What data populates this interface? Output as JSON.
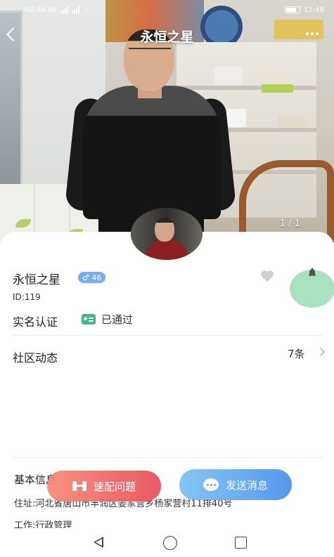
{
  "status_bar": {
    "left": "HD 46 46",
    "time": "12:48"
  },
  "header": {
    "title": "永恒之星",
    "photo_counter": "1 / 1"
  },
  "profile": {
    "name": "永恒之星",
    "gender_age": "♂ 46",
    "id": "ID:119",
    "verification": {
      "label": "实名认证",
      "status": "已通过"
    },
    "community": {
      "label": "社区动态",
      "count": "7条"
    },
    "basic_info": {
      "label": "基本信息",
      "address": "住址:河北省唐山市丰润区姜家营乡杨家营村11排40号",
      "work": "工作:行政管理"
    }
  },
  "actions": {
    "match_label": "速配问题",
    "send_label": "发送消息"
  },
  "colors": {
    "badge_blue": "#77aef0",
    "verify_green": "#39b88a",
    "match_button": "#e9525c",
    "send_button": "#4e94e9",
    "bell_bubble": "#a8e2c2"
  },
  "icons": [
    "back-icon",
    "more-icon",
    "heart-icon",
    "bell-icon",
    "verify-icon",
    "chevron-right-icon",
    "match-icon",
    "chat-icon",
    "nav-back-icon",
    "nav-home-icon",
    "nav-recent-icon"
  ]
}
